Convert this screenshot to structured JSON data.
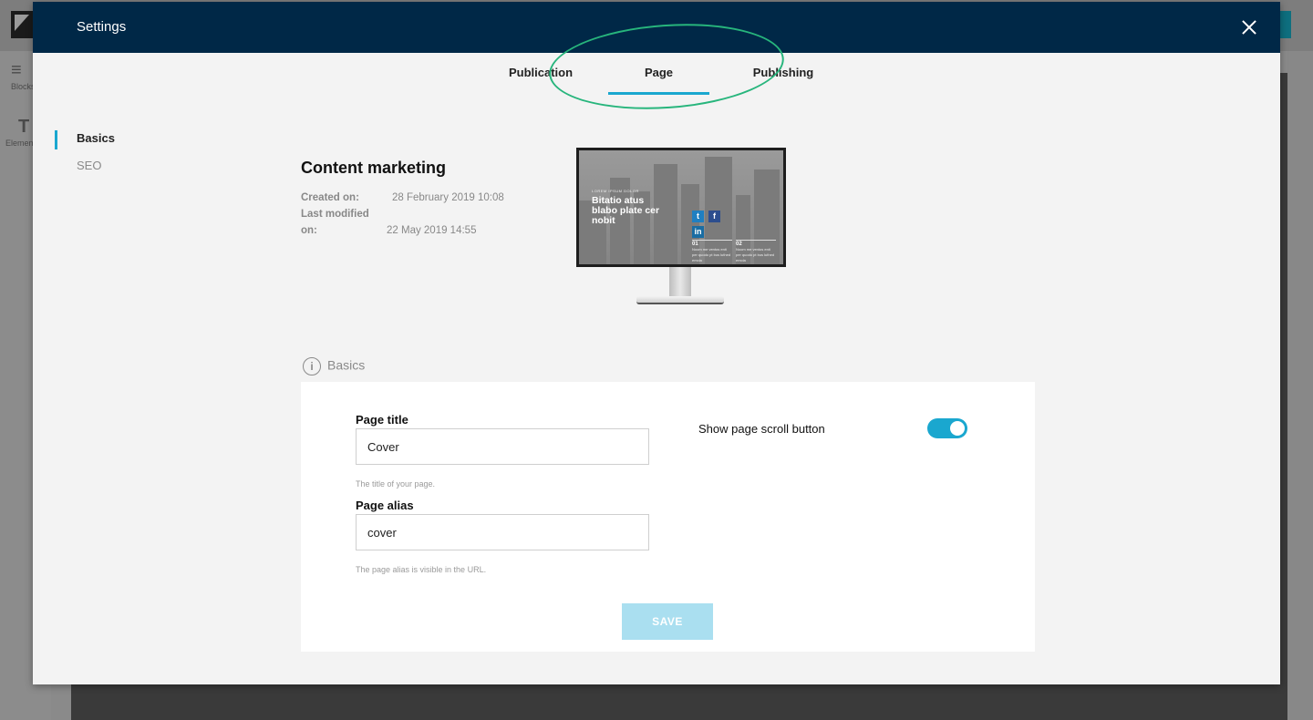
{
  "background": {
    "toolbar": [
      {
        "icon": "blocks-icon",
        "label": "Blocks"
      },
      {
        "icon": "text-icon",
        "label": "Elements"
      }
    ]
  },
  "modal": {
    "title": "Settings",
    "tabs": [
      {
        "label": "Publication",
        "active": false
      },
      {
        "label": "Page",
        "active": true
      },
      {
        "label": "Publishing",
        "active": false
      }
    ],
    "sidebar": [
      {
        "label": "Basics",
        "active": true
      },
      {
        "label": "SEO",
        "active": false
      }
    ],
    "content": {
      "title": "Content marketing",
      "created_label": "Created on:",
      "created_value": "28 February 2019 10:08",
      "modified_label": "Last modified on:",
      "modified_value": "22 May 2019 14:55"
    },
    "preview": {
      "kicker": "LOREM IPSUM DOLOR",
      "headline": "Bitatio atus blabo plate cer nobit",
      "col1_num": "01",
      "col1_text": "Noom me ventos enit per quodo pt bus luthed emola",
      "col2_num": "02",
      "col2_text": "Noom me ventos enit per quodo pt bus luthed emola"
    },
    "basics": {
      "section_label": "Basics",
      "info_icon": "i",
      "page_title_label": "Page title",
      "page_title_value": "Cover",
      "page_title_hint": "The title of your page.",
      "page_alias_label": "Page alias",
      "page_alias_value": "cover",
      "page_alias_hint": "The page alias is visible in the URL.",
      "scroll_button_label": "Show page scroll button",
      "scroll_button_enabled": true,
      "save_label": "SAVE"
    },
    "colors": {
      "header": "#002847",
      "accent": "#1aa7cf",
      "annotation": "#27b57c"
    }
  }
}
